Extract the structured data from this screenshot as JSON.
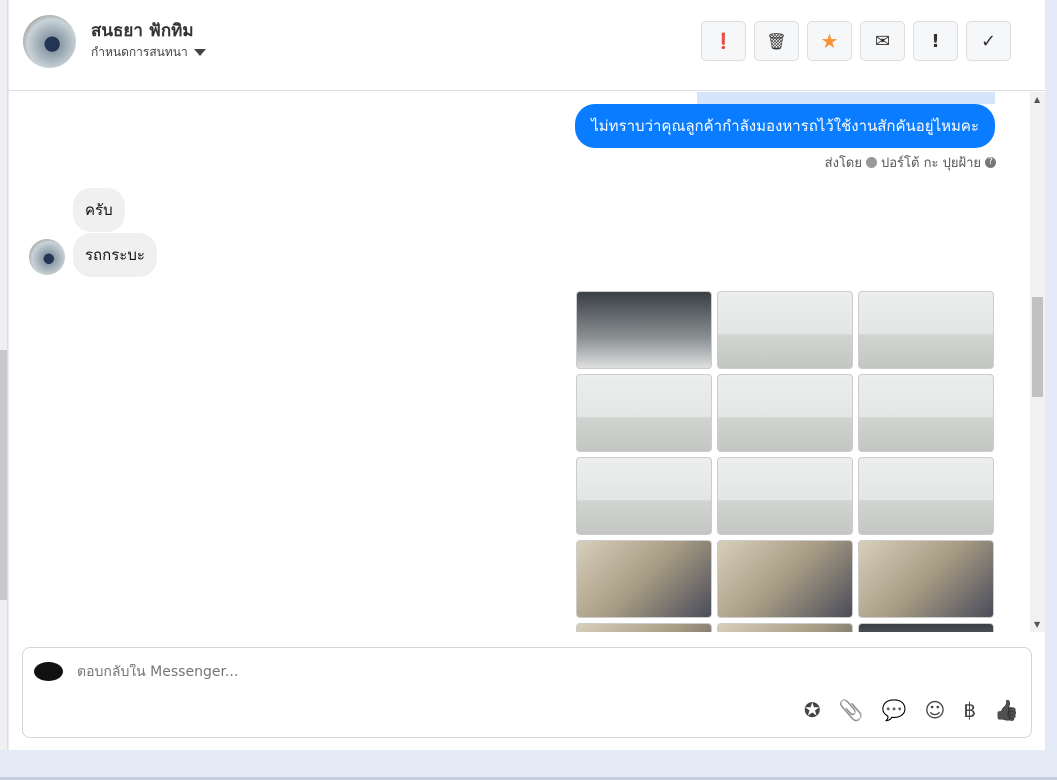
{
  "header": {
    "contact_name": "สนธยา ฟักทิม",
    "assign_label": "กำหนดการสนทนา",
    "actions": [
      {
        "name": "spam",
        "glyph": "❗"
      },
      {
        "name": "delete",
        "glyph": "🗑"
      },
      {
        "name": "star",
        "glyph": "★"
      },
      {
        "name": "mark-unread",
        "glyph": "✉"
      },
      {
        "name": "important",
        "glyph": "!"
      },
      {
        "name": "done",
        "glyph": "✓"
      }
    ]
  },
  "messages": {
    "outgoing": "ไม่ทราบว่าคุณลูกค้ากำลังมองหารถไว้ใช้งานสักคันอยู่ไหมคะ",
    "sent_by_prefix": "ส่งโดย",
    "sent_by_name": "ปอร์โต้ กะ ปุยฝ้าย",
    "help_glyph": "?",
    "incoming": [
      "ครับ",
      "รถกระบะ"
    ]
  },
  "composer": {
    "placeholder": "ตอบกลับใน Messenger...",
    "tools": [
      {
        "name": "saved-reply",
        "glyph": "✪"
      },
      {
        "name": "attach",
        "glyph": "📎"
      },
      {
        "name": "chat",
        "glyph": "💬"
      },
      {
        "name": "emoji",
        "glyph": "☺"
      },
      {
        "name": "baht",
        "glyph": "฿"
      },
      {
        "name": "like",
        "glyph": "👍"
      }
    ]
  },
  "colors": {
    "accent": "#0a7cff",
    "star": "#f7923a"
  }
}
